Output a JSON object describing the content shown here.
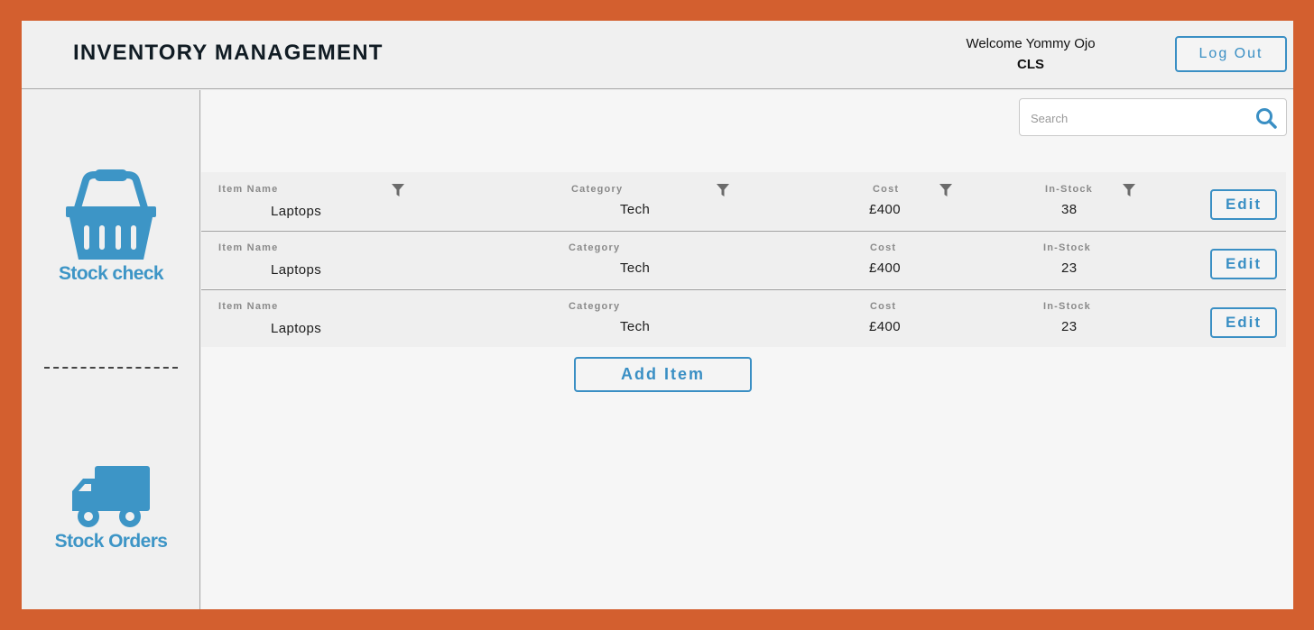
{
  "header": {
    "title": "INVENTORY MANAGEMENT",
    "welcome": "Welcome Yommy Ojo",
    "org": "CLS",
    "logout_label": "Log Out"
  },
  "sidebar": {
    "items": [
      {
        "label": "Stock check",
        "icon": "basket-icon"
      },
      {
        "label": "Stock Orders",
        "icon": "truck-icon"
      }
    ]
  },
  "search": {
    "placeholder": "Search",
    "value": ""
  },
  "table": {
    "columns": [
      "Item Name",
      "Category",
      "Cost",
      "In-Stock"
    ],
    "rows": [
      {
        "name": "Laptops",
        "category": "Tech",
        "cost": "£400",
        "stock": "38",
        "edit_label": "Edit"
      },
      {
        "name": "Laptops",
        "category": "Tech",
        "cost": "£400",
        "stock": "23",
        "edit_label": "Edit"
      },
      {
        "name": "Laptops",
        "category": "Tech",
        "cost": "£400",
        "stock": "23",
        "edit_label": "Edit"
      }
    ]
  },
  "add_item_label": "Add Item",
  "colors": {
    "accent": "#3d95c6",
    "frame": "#d35f2f",
    "filter_icon": "#6b6b6b"
  }
}
